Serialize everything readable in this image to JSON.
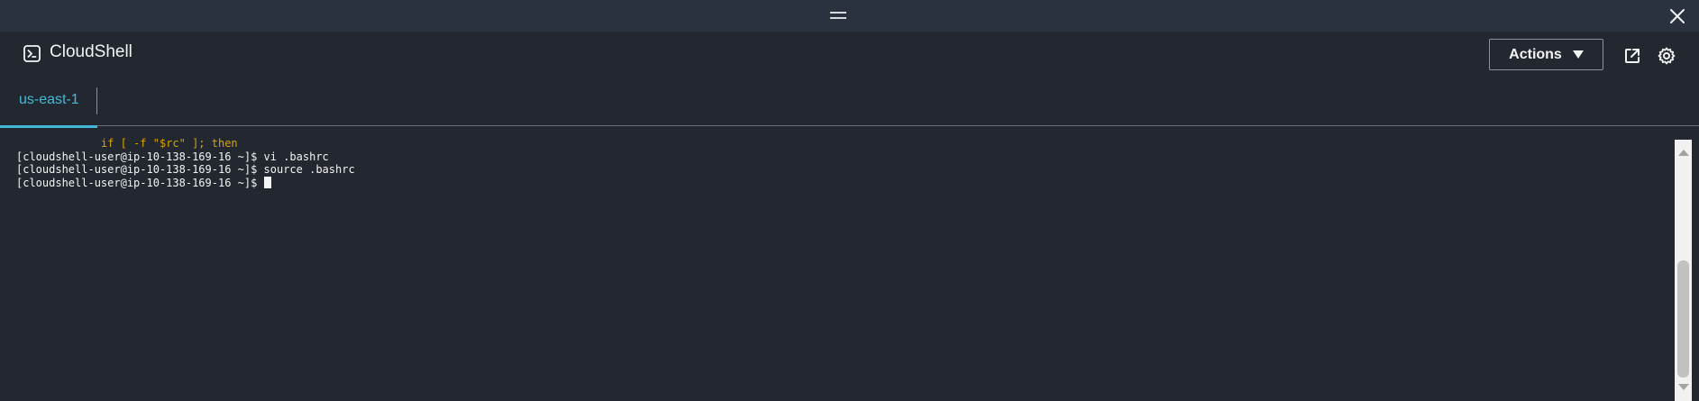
{
  "window": {
    "drag_handle_icon": "drag-handle-icon",
    "close_icon": "close-icon"
  },
  "header": {
    "app_icon": "terminal-icon",
    "title": "CloudShell",
    "actions_label": "Actions",
    "popout_icon": "external-link-icon",
    "settings_icon": "gear-icon"
  },
  "tabs": [
    {
      "label": "us-east-1",
      "active": true
    }
  ],
  "terminal": {
    "partial_line": "if [ -f \"$rc\" ]; then",
    "lines": [
      "[cloudshell-user@ip-10-138-169-16 ~]$ vi .bashrc",
      "[cloudshell-user@ip-10-138-169-16 ~]$ source .bashrc",
      "[cloudshell-user@ip-10-138-169-16 ~]$ "
    ]
  },
  "colors": {
    "background": "#232730",
    "top_strip": "#2a3240",
    "accent": "#44b9d6",
    "text": "#f2f3f3",
    "partial_keyword": "#d7a400",
    "partial_string": "#b07bb3"
  }
}
